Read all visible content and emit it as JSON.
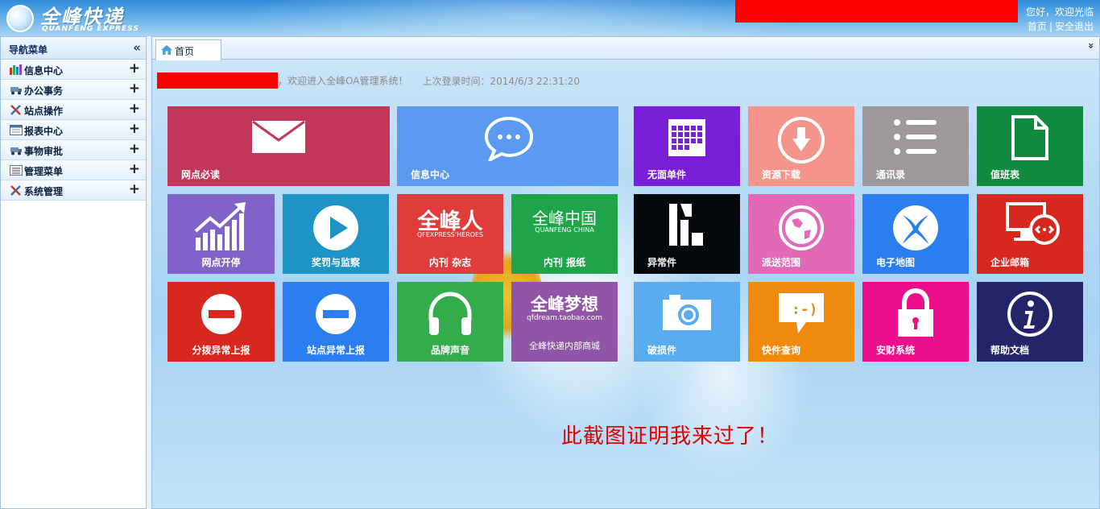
{
  "header": {
    "logo_cn": "全峰快递",
    "logo_en": "QUANFENG EXPRESS",
    "greeting": "您好，欢迎光临",
    "home_link": "首页",
    "sep": "|",
    "logout_link": "安全退出"
  },
  "sidebar": {
    "title": "导航菜单",
    "collapse_icon": "«",
    "items": [
      {
        "label": "信息中心",
        "icon": "bar-chart-icon"
      },
      {
        "label": "办公事务",
        "icon": "truck-icon"
      },
      {
        "label": "站点操作",
        "icon": "tools-icon"
      },
      {
        "label": "报表中心",
        "icon": "report-icon"
      },
      {
        "label": "事物审批",
        "icon": "truck-icon"
      },
      {
        "label": "管理菜单",
        "icon": "list-icon"
      },
      {
        "label": "系统管理",
        "icon": "tools-icon"
      }
    ],
    "expand_symbol": "+"
  },
  "tabs": {
    "home": "首页",
    "scroll_icon": "»"
  },
  "welcome": {
    "text": "，欢迎进入全峰OA管理系统！",
    "last_login": "上次登录时间：2014/6/3 22:31:20"
  },
  "tiles": {
    "t1": {
      "label": "网点必读",
      "color": "#c2365a"
    },
    "t2": {
      "label": "信息中心",
      "color": "#5b9af0"
    },
    "t3": {
      "label": "无面单件",
      "color": "#7a1fd8"
    },
    "t4": {
      "label": "资源下载",
      "color": "#f4948a"
    },
    "t5": {
      "label": "通讯录",
      "color": "#9e9999"
    },
    "t6": {
      "label": "值班表",
      "color": "#108a3e"
    },
    "t7": {
      "label": "网点开停",
      "color": "#8062c8"
    },
    "t8": {
      "label": "奖罚与监察",
      "color": "#1e94c6"
    },
    "t9": {
      "label": "内刊 杂志",
      "color": "#e03c3c",
      "big": "全峰人",
      "small": "QFEXPRESS'HEROES"
    },
    "t10": {
      "label": "内刊 报纸",
      "color": "#1fa44a",
      "big": "全峰中国",
      "small": "QUANFENG CHINA"
    },
    "t11": {
      "label": "异常件",
      "color": "#05090d"
    },
    "t12": {
      "label": "派送范围",
      "color": "#e268b8"
    },
    "t13": {
      "label": "电子地图",
      "color": "#2a7ef0"
    },
    "t14": {
      "label": "企业邮箱",
      "color": "#d8271f"
    },
    "t15": {
      "label": "分拨异常上报",
      "color": "#d8271f"
    },
    "t16": {
      "label": "站点异常上报",
      "color": "#2a7ef0"
    },
    "t17": {
      "label": "品牌声音",
      "color": "#34ac4c"
    },
    "t18": {
      "label": "全峰快递内部商城",
      "color": "#9155a8",
      "big": "全峰梦想",
      "small": "qfdream.taobao.com"
    },
    "t19": {
      "label": "破损件",
      "color": "#5aacf0"
    },
    "t20": {
      "label": "快件查询",
      "color": "#f08a0e"
    },
    "t21": {
      "label": "安财系统",
      "color": "#ec0e8a"
    },
    "t22": {
      "label": "帮助文档",
      "color": "#24246a"
    }
  },
  "proof_text": "此截图证明我来过了！"
}
